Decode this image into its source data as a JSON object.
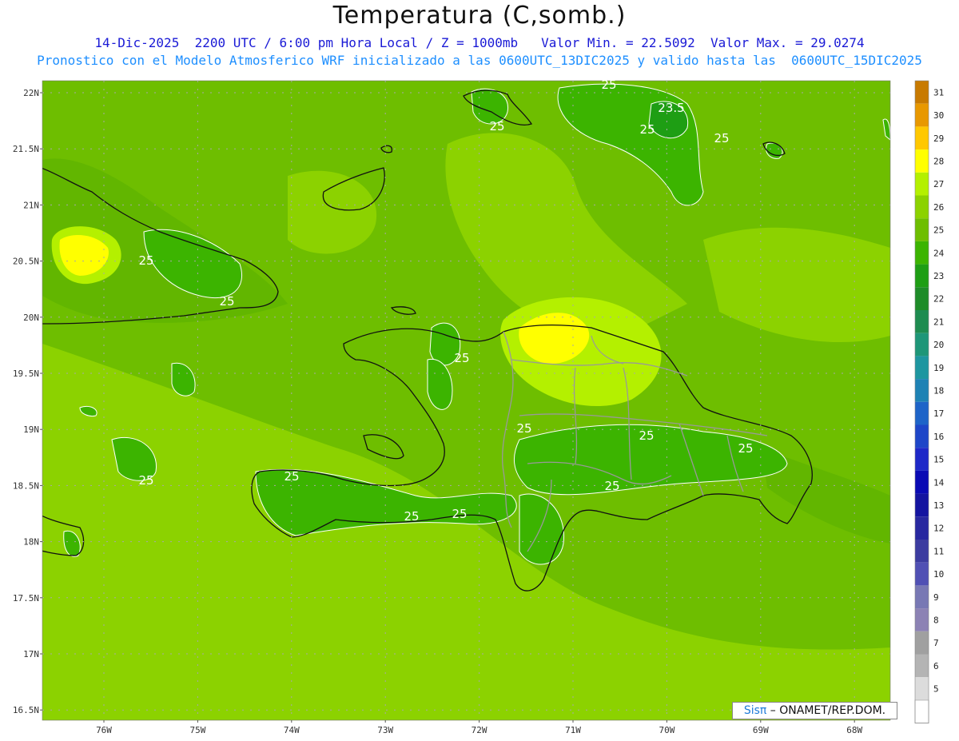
{
  "title": "Temperatura (C,somb.)",
  "subtitle": "14-Dic-2025  2200 UTC / 6:00 pm Hora Local / Z = 1000mb   Valor Min. = 22.5092  Valor Max. = 29.0274",
  "subtitle2": "Pronostico con el Modelo Atmosferico WRF inicializado a las 0600UTC_13DIC2025 y valido hasta las  0600UTC_15DIC2025",
  "credit": {
    "brand": "Sisπ",
    "text": " – ONAMET/REP.DOM."
  },
  "lat_labels": [
    "22N",
    "21.5N",
    "21N",
    "20.5N",
    "20N",
    "19.5N",
    "19N",
    "18.5N",
    "18N",
    "17.5N",
    "17N",
    "16.5N"
  ],
  "lon_labels": [
    "76W",
    "75W",
    "74W",
    "73W",
    "72W",
    "71W",
    "70W",
    "69W",
    "68W"
  ],
  "colorbar": {
    "levels": [
      "31",
      "30",
      "29",
      "28",
      "27",
      "26",
      "25",
      "24",
      "23",
      "22",
      "21",
      "20",
      "19",
      "18",
      "17",
      "16",
      "15",
      "14",
      "13",
      "12",
      "11",
      "10",
      "9",
      "8",
      "7",
      "6",
      "5"
    ],
    "colors": [
      "#c87a00",
      "#e89800",
      "#ffc800",
      "#ffff00",
      "#b4f000",
      "#8cd200",
      "#6ebe00",
      "#3cb400",
      "#1e9e14",
      "#1e8c28",
      "#1e8c50",
      "#1e9678",
      "#1e96a0",
      "#1e82b4",
      "#1e64c8",
      "#1e46c8",
      "#1e28c8",
      "#0a0ab4",
      "#1414a0",
      "#2828a0",
      "#3c3ca0",
      "#5050b4",
      "#7878b4",
      "#8c82b4",
      "#a0a0a0",
      "#b4b4b4",
      "#dcdcdc"
    ]
  },
  "contour_labels": [
    "25",
    "25",
    "25",
    "25",
    "25",
    "25",
    "25",
    "25",
    "25",
    "25",
    "25",
    "25",
    "25",
    "25",
    "25",
    "23.5",
    "25",
    "25",
    "25"
  ]
}
